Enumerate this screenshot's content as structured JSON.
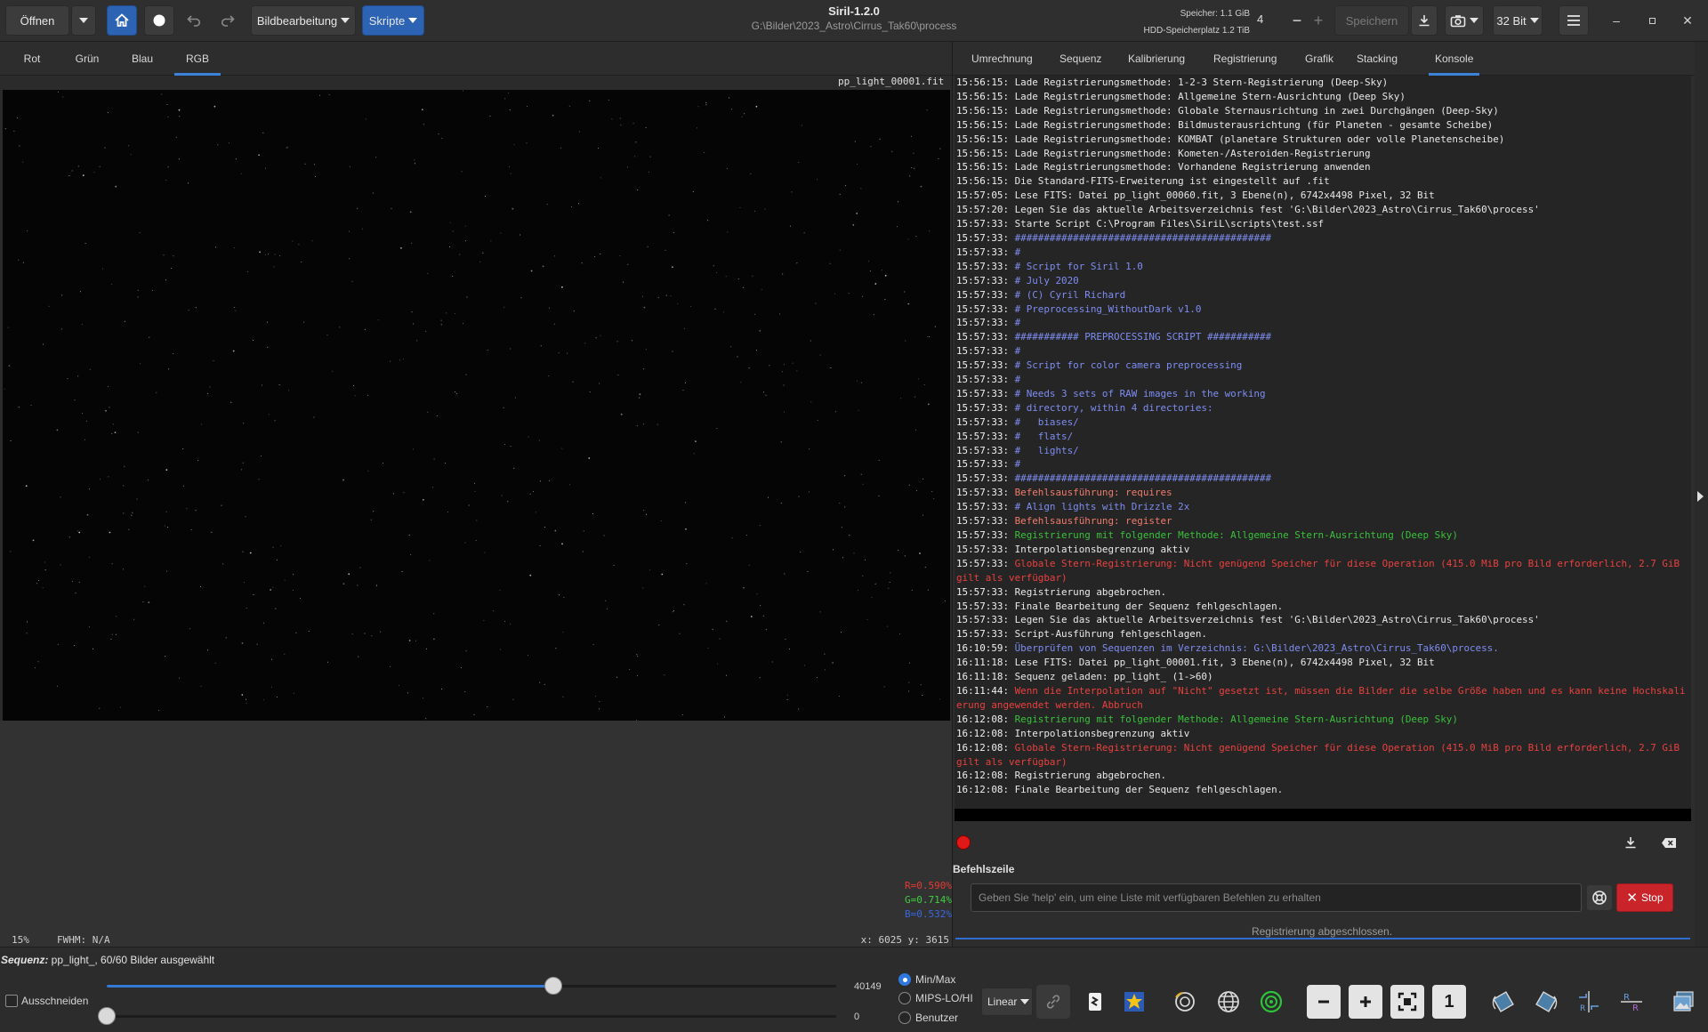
{
  "header": {
    "open_label": "Öffnen",
    "image_processing_label": "Bildbearbeitung",
    "scripts_label": "Skripte",
    "title": "Siril-1.2.0",
    "subtitle": "G:\\Bilder\\2023_Astro\\Cirrus_Tak60\\process",
    "memory_label": "Speicher: 1.1 GiB",
    "disk_label": "HDD-Speicherplatz 1.2 TiB",
    "threads_value": "4",
    "save_label": "Speichern",
    "bitdepth_label": "32 Bit"
  },
  "left_tabs": [
    "Rot",
    "Grün",
    "Blau",
    "RGB"
  ],
  "image_file": "pp_light_00001.fit",
  "image_stats": {
    "r": "R=0.590%",
    "g": "G=0.714%",
    "b": "B=0.532%",
    "zoom": "15%",
    "fwhm": "FWHM: N/A",
    "coords": "x: 6025 y: 3615"
  },
  "right_tabs": [
    "Umrechnung",
    "Sequenz",
    "Kalibrierung",
    "Registrierung",
    "Grafik",
    "Stacking",
    "Konsole"
  ],
  "console_log": [
    {
      "t": "15:56:15:",
      "m": "Lade Registrierungsmethode: 1-2-3 Stern-Registrierung (Deep-Sky)",
      "c": "white"
    },
    {
      "t": "15:56:15:",
      "m": "Lade Registrierungsmethode: Allgemeine Stern-Ausrichtung (Deep Sky)",
      "c": "white"
    },
    {
      "t": "15:56:15:",
      "m": "Lade Registrierungsmethode: Globale Sternausrichtung in zwei Durchgängen (Deep-Sky)",
      "c": "white"
    },
    {
      "t": "15:56:15:",
      "m": "Lade Registrierungsmethode: Bildmusterausrichtung (für Planeten - gesamte Scheibe)",
      "c": "white"
    },
    {
      "t": "15:56:15:",
      "m": "Lade Registrierungsmethode: KOMBAT (planetare Strukturen oder volle Planetenscheibe)",
      "c": "white"
    },
    {
      "t": "15:56:15:",
      "m": "Lade Registrierungsmethode: Kometen-/Asteroiden-Registrierung",
      "c": "white"
    },
    {
      "t": "15:56:15:",
      "m": "Lade Registrierungsmethode: Vorhandene Registrierung anwenden",
      "c": "white"
    },
    {
      "t": "15:56:15:",
      "m": "Die Standard-FITS-Erweiterung ist eingestellt auf .fit",
      "c": "white"
    },
    {
      "t": "15:57:05:",
      "m": "Lese FITS: Datei pp_light_00060.fit, 3 Ebene(n), 6742x4498 Pixel, 32 Bit",
      "c": "white"
    },
    {
      "t": "15:57:20:",
      "m": "Legen Sie das aktuelle Arbeitsverzeichnis fest 'G:\\Bilder\\2023_Astro\\Cirrus_Tak60\\process'",
      "c": "white"
    },
    {
      "t": "15:57:33:",
      "m": "Starte Script C:\\Program Files\\SiriL\\scripts\\test.ssf",
      "c": "white"
    },
    {
      "t": "15:57:33:",
      "m": "############################################",
      "c": "blue"
    },
    {
      "t": "15:57:33:",
      "m": "#",
      "c": "blue"
    },
    {
      "t": "15:57:33:",
      "m": "# Script for Siril 1.0",
      "c": "blue"
    },
    {
      "t": "15:57:33:",
      "m": "# July 2020",
      "c": "blue"
    },
    {
      "t": "15:57:33:",
      "m": "# (C) Cyril Richard",
      "c": "blue"
    },
    {
      "t": "15:57:33:",
      "m": "# Preprocessing_WithoutDark v1.0",
      "c": "blue"
    },
    {
      "t": "15:57:33:",
      "m": "#",
      "c": "blue"
    },
    {
      "t": "15:57:33:",
      "m": "########### PREPROCESSING SCRIPT ###########",
      "c": "blue"
    },
    {
      "t": "15:57:33:",
      "m": "#",
      "c": "blue"
    },
    {
      "t": "15:57:33:",
      "m": "# Script for color camera preprocessing",
      "c": "blue"
    },
    {
      "t": "15:57:33:",
      "m": "#",
      "c": "blue"
    },
    {
      "t": "15:57:33:",
      "m": "# Needs 3 sets of RAW images in the working",
      "c": "blue"
    },
    {
      "t": "15:57:33:",
      "m": "# directory, within 4 directories:",
      "c": "blue"
    },
    {
      "t": "15:57:33:",
      "m": "#   biases/",
      "c": "blue"
    },
    {
      "t": "15:57:33:",
      "m": "#   flats/",
      "c": "blue"
    },
    {
      "t": "15:57:33:",
      "m": "#   lights/",
      "c": "blue"
    },
    {
      "t": "15:57:33:",
      "m": "#",
      "c": "blue"
    },
    {
      "t": "15:57:33:",
      "m": "############################################",
      "c": "blue"
    },
    {
      "t": "15:57:33:",
      "m": "Befehlsausführung: requires",
      "c": "salmon"
    },
    {
      "t": "15:57:33:",
      "m": "# Align lights with Drizzle 2x",
      "c": "blue"
    },
    {
      "t": "15:57:33:",
      "m": "Befehlsausführung: register",
      "c": "salmon"
    },
    {
      "t": "15:57:33:",
      "m": "Registrierung mit folgender Methode: Allgemeine Stern-Ausrichtung (Deep Sky)",
      "c": "green"
    },
    {
      "t": "15:57:33:",
      "m": "Interpolationsbegrenzung aktiv",
      "c": "white"
    },
    {
      "t": "15:57:33:",
      "m": "Globale Stern-Registrierung: Nicht genügend Speicher für diese Operation (415.0 MiB pro Bild erforderlich, 2.7 GiB gilt als verfügbar)",
      "c": "red"
    },
    {
      "t": "15:57:33:",
      "m": "Registrierung abgebrochen.",
      "c": "white"
    },
    {
      "t": "15:57:33:",
      "m": "Finale Bearbeitung der Sequenz fehlgeschlagen.",
      "c": "white"
    },
    {
      "t": "15:57:33:",
      "m": "Legen Sie das aktuelle Arbeitsverzeichnis fest 'G:\\Bilder\\2023_Astro\\Cirrus_Tak60\\process'",
      "c": "white"
    },
    {
      "t": "15:57:33:",
      "m": "Script-Ausführung fehlgeschlagen.",
      "c": "white"
    },
    {
      "t": "16:10:59:",
      "m": "Überprüfen von Sequenzen im Verzeichnis: G:\\Bilder\\2023_Astro\\Cirrus_Tak60\\process.",
      "c": "blue"
    },
    {
      "t": "16:11:18:",
      "m": "Lese FITS: Datei pp_light_00001.fit, 3 Ebene(n), 6742x4498 Pixel, 32 Bit",
      "c": "white"
    },
    {
      "t": "16:11:18:",
      "m": "Sequenz geladen: pp_light_ (1->60)",
      "c": "white"
    },
    {
      "t": "16:11:44:",
      "m": "Wenn die Interpolation auf \"Nicht\" gesetzt ist, müssen die Bilder die selbe Größe haben und es kann keine Hochskalierung angewendet werden. Abbruch",
      "c": "red"
    },
    {
      "t": "16:12:08:",
      "m": "Registrierung mit folgender Methode: Allgemeine Stern-Ausrichtung (Deep Sky)",
      "c": "green"
    },
    {
      "t": "16:12:08:",
      "m": "Interpolationsbegrenzung aktiv",
      "c": "white"
    },
    {
      "t": "16:12:08:",
      "m": "Globale Stern-Registrierung: Nicht genügend Speicher für diese Operation (415.0 MiB pro Bild erforderlich, 2.7 GiB gilt als verfügbar)",
      "c": "red"
    },
    {
      "t": "16:12:08:",
      "m": "Registrierung abgebrochen.",
      "c": "white"
    },
    {
      "t": "16:12:08:",
      "m": "Finale Bearbeitung der Sequenz fehlgeschlagen.",
      "c": "white"
    }
  ],
  "command": {
    "label": "Befehlszeile",
    "placeholder": "Geben Sie 'help' ein, um eine Liste mit verfügbaren Befehlen zu erhalten",
    "stop_label": "Stop",
    "status": "Registrierung abgeschlossen."
  },
  "bottom": {
    "sequence_label": "Sequenz:",
    "sequence_value": " pp_light_, 60/60 Bilder ausgewählt",
    "crop_label": "Ausschneiden",
    "high_value": "40149",
    "low_value": "0",
    "high_slider_fraction": 0.612,
    "low_slider_fraction": 0.0,
    "scale_options": [
      "Min/Max",
      "MIPS-LO/HI",
      "Benutzer"
    ],
    "selected_scale": "Min/Max",
    "stretch_mode": "Linear",
    "zoom_one_label": "1"
  },
  "colors": {
    "accent": "#3b82d9",
    "stop": "#c8242a",
    "log_blue": "#7d8df2",
    "log_green": "#39c13a",
    "log_red": "#e8413f"
  }
}
